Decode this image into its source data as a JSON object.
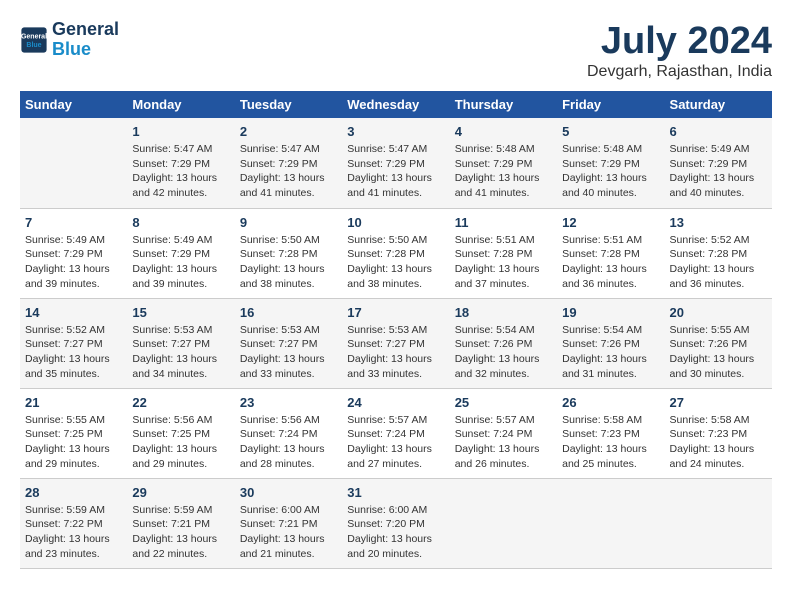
{
  "logo": {
    "line1": "General",
    "line2": "Blue"
  },
  "title": "July 2024",
  "subtitle": "Devgarh, Rajasthan, India",
  "days_header": [
    "Sunday",
    "Monday",
    "Tuesday",
    "Wednesday",
    "Thursday",
    "Friday",
    "Saturday"
  ],
  "weeks": [
    [
      {
        "day": "",
        "info": ""
      },
      {
        "day": "1",
        "info": "Sunrise: 5:47 AM\nSunset: 7:29 PM\nDaylight: 13 hours\nand 42 minutes."
      },
      {
        "day": "2",
        "info": "Sunrise: 5:47 AM\nSunset: 7:29 PM\nDaylight: 13 hours\nand 41 minutes."
      },
      {
        "day": "3",
        "info": "Sunrise: 5:47 AM\nSunset: 7:29 PM\nDaylight: 13 hours\nand 41 minutes."
      },
      {
        "day": "4",
        "info": "Sunrise: 5:48 AM\nSunset: 7:29 PM\nDaylight: 13 hours\nand 41 minutes."
      },
      {
        "day": "5",
        "info": "Sunrise: 5:48 AM\nSunset: 7:29 PM\nDaylight: 13 hours\nand 40 minutes."
      },
      {
        "day": "6",
        "info": "Sunrise: 5:49 AM\nSunset: 7:29 PM\nDaylight: 13 hours\nand 40 minutes."
      }
    ],
    [
      {
        "day": "7",
        "info": "Sunrise: 5:49 AM\nSunset: 7:29 PM\nDaylight: 13 hours\nand 39 minutes."
      },
      {
        "day": "8",
        "info": "Sunrise: 5:49 AM\nSunset: 7:29 PM\nDaylight: 13 hours\nand 39 minutes."
      },
      {
        "day": "9",
        "info": "Sunrise: 5:50 AM\nSunset: 7:28 PM\nDaylight: 13 hours\nand 38 minutes."
      },
      {
        "day": "10",
        "info": "Sunrise: 5:50 AM\nSunset: 7:28 PM\nDaylight: 13 hours\nand 38 minutes."
      },
      {
        "day": "11",
        "info": "Sunrise: 5:51 AM\nSunset: 7:28 PM\nDaylight: 13 hours\nand 37 minutes."
      },
      {
        "day": "12",
        "info": "Sunrise: 5:51 AM\nSunset: 7:28 PM\nDaylight: 13 hours\nand 36 minutes."
      },
      {
        "day": "13",
        "info": "Sunrise: 5:52 AM\nSunset: 7:28 PM\nDaylight: 13 hours\nand 36 minutes."
      }
    ],
    [
      {
        "day": "14",
        "info": "Sunrise: 5:52 AM\nSunset: 7:27 PM\nDaylight: 13 hours\nand 35 minutes."
      },
      {
        "day": "15",
        "info": "Sunrise: 5:53 AM\nSunset: 7:27 PM\nDaylight: 13 hours\nand 34 minutes."
      },
      {
        "day": "16",
        "info": "Sunrise: 5:53 AM\nSunset: 7:27 PM\nDaylight: 13 hours\nand 33 minutes."
      },
      {
        "day": "17",
        "info": "Sunrise: 5:53 AM\nSunset: 7:27 PM\nDaylight: 13 hours\nand 33 minutes."
      },
      {
        "day": "18",
        "info": "Sunrise: 5:54 AM\nSunset: 7:26 PM\nDaylight: 13 hours\nand 32 minutes."
      },
      {
        "day": "19",
        "info": "Sunrise: 5:54 AM\nSunset: 7:26 PM\nDaylight: 13 hours\nand 31 minutes."
      },
      {
        "day": "20",
        "info": "Sunrise: 5:55 AM\nSunset: 7:26 PM\nDaylight: 13 hours\nand 30 minutes."
      }
    ],
    [
      {
        "day": "21",
        "info": "Sunrise: 5:55 AM\nSunset: 7:25 PM\nDaylight: 13 hours\nand 29 minutes."
      },
      {
        "day": "22",
        "info": "Sunrise: 5:56 AM\nSunset: 7:25 PM\nDaylight: 13 hours\nand 29 minutes."
      },
      {
        "day": "23",
        "info": "Sunrise: 5:56 AM\nSunset: 7:24 PM\nDaylight: 13 hours\nand 28 minutes."
      },
      {
        "day": "24",
        "info": "Sunrise: 5:57 AM\nSunset: 7:24 PM\nDaylight: 13 hours\nand 27 minutes."
      },
      {
        "day": "25",
        "info": "Sunrise: 5:57 AM\nSunset: 7:24 PM\nDaylight: 13 hours\nand 26 minutes."
      },
      {
        "day": "26",
        "info": "Sunrise: 5:58 AM\nSunset: 7:23 PM\nDaylight: 13 hours\nand 25 minutes."
      },
      {
        "day": "27",
        "info": "Sunrise: 5:58 AM\nSunset: 7:23 PM\nDaylight: 13 hours\nand 24 minutes."
      }
    ],
    [
      {
        "day": "28",
        "info": "Sunrise: 5:59 AM\nSunset: 7:22 PM\nDaylight: 13 hours\nand 23 minutes."
      },
      {
        "day": "29",
        "info": "Sunrise: 5:59 AM\nSunset: 7:21 PM\nDaylight: 13 hours\nand 22 minutes."
      },
      {
        "day": "30",
        "info": "Sunrise: 6:00 AM\nSunset: 7:21 PM\nDaylight: 13 hours\nand 21 minutes."
      },
      {
        "day": "31",
        "info": "Sunrise: 6:00 AM\nSunset: 7:20 PM\nDaylight: 13 hours\nand 20 minutes."
      },
      {
        "day": "",
        "info": ""
      },
      {
        "day": "",
        "info": ""
      },
      {
        "day": "",
        "info": ""
      }
    ]
  ]
}
